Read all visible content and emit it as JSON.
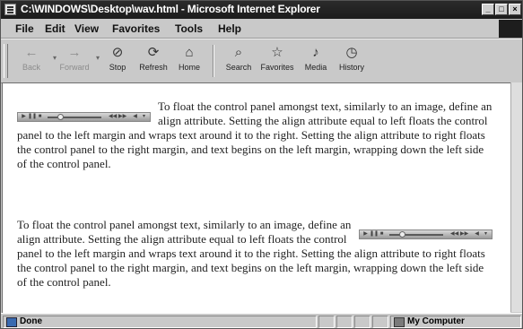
{
  "window": {
    "title": "C:\\WINDOWS\\Desktop\\wav.html - Microsoft Internet Explorer",
    "controls": [
      "_",
      "□",
      "×"
    ]
  },
  "menu": [
    "File",
    "Edit",
    "View",
    "Favorites",
    "Tools",
    "Help"
  ],
  "toolbar": [
    {
      "label": "Back",
      "icon": "←",
      "enabled": false
    },
    {
      "label": "Forward",
      "icon": "→",
      "enabled": false
    },
    {
      "label": "Stop",
      "icon": "⊘",
      "enabled": true
    },
    {
      "label": "Refresh",
      "icon": "⟳",
      "enabled": true
    },
    {
      "label": "Home",
      "icon": "⌂",
      "enabled": true
    },
    {
      "label": "Search",
      "icon": "⌕",
      "enabled": true
    },
    {
      "label": "Favorites",
      "icon": "☆",
      "enabled": true
    },
    {
      "label": "Media",
      "icon": "♪",
      "enabled": true
    },
    {
      "label": "History",
      "icon": "◷",
      "enabled": true
    }
  ],
  "content": {
    "paragraph1": "To float the control panel amongst text, similarly to an image, define an align attribute. Setting the align attribute equal to left floats the control panel to the left margin and wraps text around it to the right. Setting the align attribute to right floats the control panel to the right margin, and text begins on the left margin, wrapping down the left side of the control panel.",
    "paragraph2": "To float the control panel amongst text, similarly to an image, define an align attribute. Setting the align attribute equal to left floats the control panel to the left margin and wraps text around it to the right. Setting the align attribute to right floats the control panel to the right margin, and text begins on the left margin, wrapping down the left side of the control panel.",
    "player1": {
      "align": "left",
      "position": 0.25
    },
    "player2": {
      "align": "right",
      "position": 0.25
    }
  },
  "status": {
    "text": "Done",
    "zone": "My Computer"
  }
}
